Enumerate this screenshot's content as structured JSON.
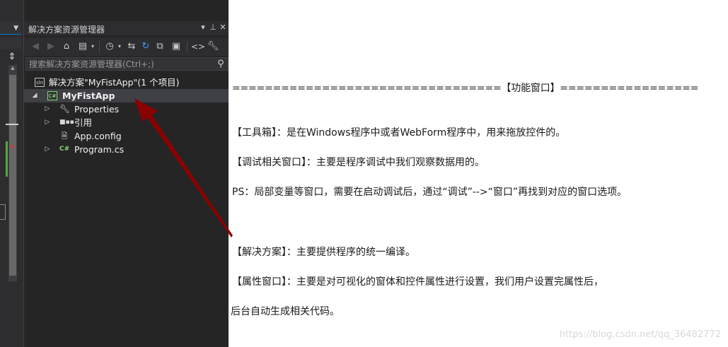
{
  "solution_explorer": {
    "title": "解决方案资源管理器",
    "title_buttons": [
      "▾",
      "⊥",
      "✕"
    ],
    "search_placeholder": "搜索解决方案资源管理器(Ctrl+;)",
    "tree": {
      "solution_label": "解决方案\"MyFistApp\"(1 个项目)",
      "project_label": "MyFistApp",
      "items": [
        {
          "label": "Properties",
          "icon": "wrench-icon",
          "expandable": true
        },
        {
          "label": "引用",
          "icon": "reference-icon",
          "expandable": true
        },
        {
          "label": "App.config",
          "icon": "config-file-icon",
          "expandable": false
        },
        {
          "label": "Program.cs",
          "icon": "csharp-file-icon",
          "expandable": true
        }
      ]
    },
    "icons": {
      "solution": "sln",
      "project": "C#",
      "csharp_file": "C#"
    }
  },
  "document": {
    "header_line": "=================================【功能窗口】=================",
    "lines": [
      "【工具箱】：是在Windows程序中或者WebForm程序中，用来拖放控件的。",
      "【调试相关窗口】：主要是程序调试中我们观察数据用的。",
      "PS：局部变量等窗口，需要在启动调试后，通过“调试”-->“窗口”再找到对应的窗口选项。",
      "【解决方案】：主要提供程序的统一编译。",
      "【属性窗口】：主要是对可视化的窗体和控件属性进行设置，我们用户设置完属性后，",
      "后台自动生成相关代码。"
    ],
    "watermark": "https://blog.csdn.net/qq_36482772"
  },
  "colors": {
    "ide_bg": "#252526",
    "selection": "#3f3f46",
    "arrow": "#8b0000",
    "accent": "#007acc"
  }
}
